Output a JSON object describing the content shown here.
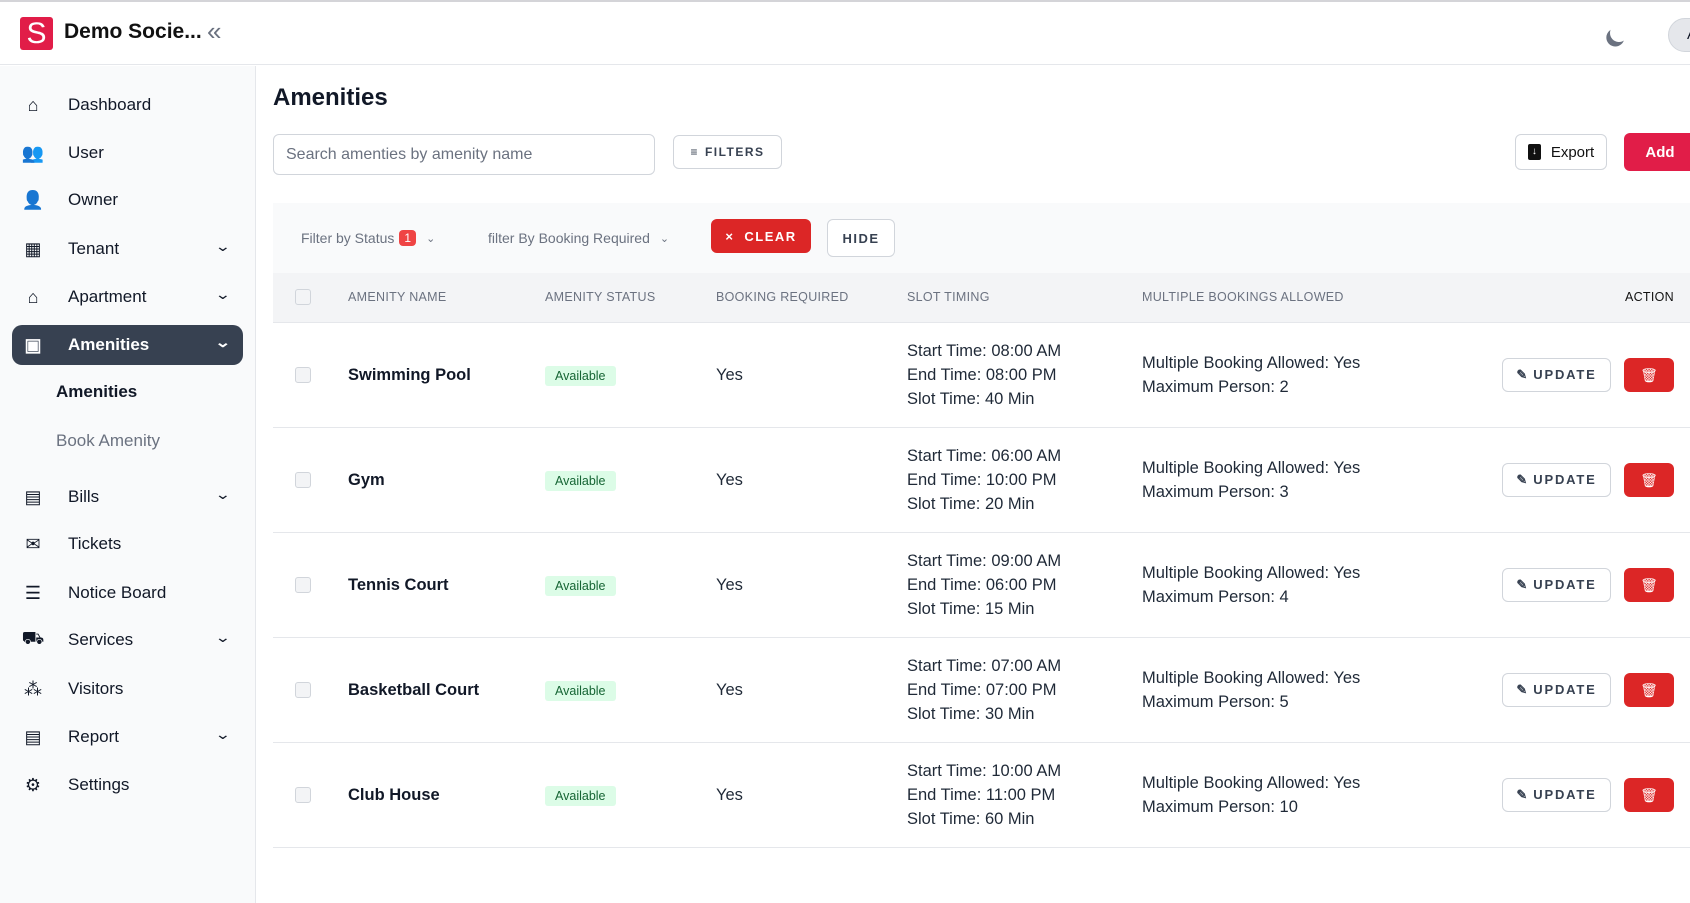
{
  "header": {
    "logo_letter": "S",
    "brand": "Demo Socie...",
    "avatar_initial": "A",
    "theme_icon": "moon-icon",
    "collapse_icon": "chevrons-left-icon"
  },
  "colors": {
    "brand": "#e11d48",
    "danger": "#dc2626",
    "sidebar_active": "#374151",
    "status_bg": "#dcfce7"
  },
  "sidebar": {
    "items": [
      {
        "label": "Dashboard",
        "icon": "home-icon",
        "glyph": "⌂",
        "chevron": false
      },
      {
        "label": "User",
        "icon": "users-icon",
        "glyph": "👥",
        "chevron": false
      },
      {
        "label": "Owner",
        "icon": "owner-icon",
        "glyph": "👤",
        "chevron": false
      },
      {
        "label": "Tenant",
        "icon": "tenant-icon",
        "glyph": "▦",
        "chevron": true
      },
      {
        "label": "Apartment",
        "icon": "apartment-icon",
        "glyph": "⌂",
        "chevron": true
      },
      {
        "label": "Amenities",
        "icon": "amenities-icon",
        "glyph": "▣",
        "chevron": true,
        "active": true
      },
      {
        "label": "Bills",
        "icon": "bills-icon",
        "glyph": "▤",
        "chevron": true
      },
      {
        "label": "Tickets",
        "icon": "tickets-icon",
        "glyph": "✉",
        "chevron": false
      },
      {
        "label": "Notice Board",
        "icon": "notice-board-icon",
        "glyph": "☰",
        "chevron": false
      },
      {
        "label": "Services",
        "icon": "services-icon",
        "glyph": "⛟",
        "chevron": true
      },
      {
        "label": "Visitors",
        "icon": "visitors-icon",
        "glyph": "⁂",
        "chevron": false
      },
      {
        "label": "Report",
        "icon": "report-icon",
        "glyph": "▤",
        "chevron": true
      },
      {
        "label": "Settings",
        "icon": "settings-icon",
        "glyph": "⚙",
        "chevron": false
      }
    ],
    "subitems": [
      {
        "label": "Amenities",
        "active": true
      },
      {
        "label": "Book Amenity"
      }
    ]
  },
  "main": {
    "title": "Amenities",
    "search_placeholder": "Search amenties by amenity name",
    "filters_label": "FILTERS",
    "export_label": "Export",
    "add_label": "Add",
    "filter_status_label": "Filter by Status",
    "filter_status_count": "1",
    "filter_booking_label": "filter By Booking Required",
    "clear_label": "CLEAR",
    "hide_label": "HIDE",
    "columns": [
      "AMENITY NAME",
      "AMENITY STATUS",
      "BOOKING REQUIRED",
      "SLOT TIMING",
      "MULTIPLE BOOKINGS ALLOWED",
      "ACTION"
    ],
    "update_label": "UPDATE",
    "rows": [
      {
        "name": "Swimming Pool",
        "status": "Available",
        "booking": "Yes",
        "start": "Start Time: 08:00 AM",
        "end": "End Time: 08:00 PM",
        "slot": "Slot Time: 40 Min",
        "multiple": "Multiple Booking Allowed: Yes",
        "max": "Maximum Person: 2"
      },
      {
        "name": "Gym",
        "status": "Available",
        "booking": "Yes",
        "start": "Start Time: 06:00 AM",
        "end": "End Time: 10:00 PM",
        "slot": "Slot Time: 20 Min",
        "multiple": "Multiple Booking Allowed: Yes",
        "max": "Maximum Person: 3"
      },
      {
        "name": "Tennis Court",
        "status": "Available",
        "booking": "Yes",
        "start": "Start Time: 09:00 AM",
        "end": "End Time: 06:00 PM",
        "slot": "Slot Time: 15 Min",
        "multiple": "Multiple Booking Allowed: Yes",
        "max": "Maximum Person: 4"
      },
      {
        "name": "Basketball Court",
        "status": "Available",
        "booking": "Yes",
        "start": "Start Time: 07:00 AM",
        "end": "End Time: 07:00 PM",
        "slot": "Slot Time: 30 Min",
        "multiple": "Multiple Booking Allowed: Yes",
        "max": "Maximum Person: 5"
      },
      {
        "name": "Club House",
        "status": "Available",
        "booking": "Yes",
        "start": "Start Time: 10:00 AM",
        "end": "End Time: 11:00 PM",
        "slot": "Slot Time: 60 Min",
        "multiple": "Multiple Booking Allowed: Yes",
        "max": "Maximum Person: 10"
      }
    ]
  }
}
